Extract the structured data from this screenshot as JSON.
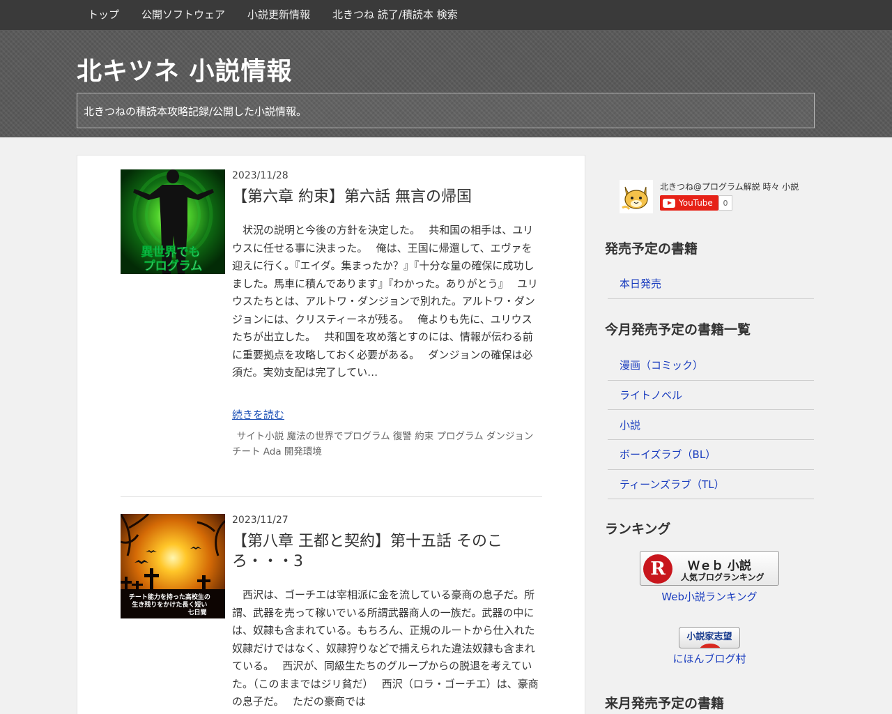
{
  "nav": {
    "items": [
      "トップ",
      "公開ソフトウェア",
      "小説更新情報",
      "北きつね 読了/積読本 検索"
    ]
  },
  "header": {
    "site_title": "北キツネ 小説情報",
    "tagline": "北きつねの積読本攻略記録/公開した小説情報。"
  },
  "posts": [
    {
      "date": "2023/11/28",
      "title": "【第六章 約束】第六話 無言の帰国",
      "thumb_text": "異世界でも\nプログラム",
      "excerpt": "状況の説明と今後の方針を決定した。　 共和国の相手は、ユリウスに任せる事に決まった。　 俺は、王国に帰還して、エヴァを迎えに行く。『エイダ。集まったか？』『十分な量の確保に成功しました。馬車に積んであります』『わかった。ありがとう』　 ユリウスたちとは、アルトワ・ダンジョンで別れた。アルトワ・ダンジョンには、クリスティーネが残る。　 俺よりも先に、ユリウスたちが出立した。　 共和国を攻め落とすのには、情報が伝わる前に重要拠点を攻略しておく必要がある。　 ダンジョンの確保は必須だ。実効支配は完了してい…",
      "readmore": "続きを読む",
      "tags": "サイト小説 魔法の世界でプログラム 復讐 約束 プログラム ダンジョン チート Ada 開発環境"
    },
    {
      "date": "2023/11/27",
      "title": "【第八章 王都と契約】第十五話 そのころ・・・3",
      "thumb_text": "チート能力を持った高校生の\n生き残りをかけた長く短い\n七日間",
      "excerpt": "西沢は、ゴーチエは宰相派に金を流している豪商の息子だ。所謂、武器を売って稼いでいる所謂武器商人の一族だ。武器の中には、奴隷も含まれている。もちろん、正規のルートから仕入れた奴隷だけではなく、奴隷狩りなどで捕えられた違法奴隷も含まれている。　 西沢が、同級生たちのグループからの脱退を考えていた。（このままではジリ貧だ）　 西沢（ロラ・ゴーチエ）は、豪商の息子だ。　 ただの豪商では"
    }
  ],
  "sidebar": {
    "youtube": {
      "channel_name": "北きつね@プログラム解説 時々 小説",
      "button_label": "YouTube",
      "count": "0"
    },
    "widget1": {
      "title": "発売予定の書籍",
      "items": [
        "本日発売"
      ]
    },
    "widget2": {
      "title": "今月発売予定の書籍一覧",
      "items": [
        "漫画（コミック）",
        "ライトノベル",
        "小説",
        "ボーイズラブ（BL）",
        "ティーンズラブ（TL）"
      ]
    },
    "ranking": {
      "title": "ランキング",
      "banner1_main": "Ｗｅｂ 小説",
      "banner1_sub": "人気ブログランキング",
      "banner1_logo": "R",
      "link1": "Web小説ランキング",
      "banner2_text": "小説家志望",
      "link2": "にほんブログ村"
    },
    "widget3": {
      "title": "来月発売予定の書籍"
    }
  },
  "colors": {
    "nav_bg": "#3a3a3a",
    "header_bg": "#5a5a5a",
    "link": "#1a3dbf",
    "youtube_red": "#e62117"
  }
}
